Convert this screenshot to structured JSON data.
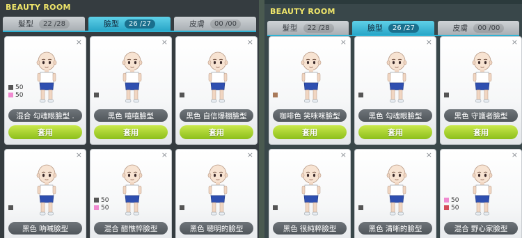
{
  "left_panel": {
    "title": "BEAUTY ROOM",
    "tabs": [
      {
        "label": "髮型",
        "count": "22 /28",
        "active": false
      },
      {
        "label": "臉型",
        "count": "26 /27",
        "active": true
      },
      {
        "label": "皮膚",
        "count": "00 /00",
        "active": false
      }
    ],
    "cards": [
      {
        "name": "混合 勾魂眼臉型 .",
        "swatches": [
          {
            "color": "#555555",
            "value": "50"
          },
          {
            "color": "#f08ad0",
            "value": "50"
          }
        ],
        "button": "套用"
      },
      {
        "name": "黑色 嘻嘻臉型",
        "swatches": [
          {
            "color": "#555555",
            "value": ""
          }
        ],
        "button": "套用"
      },
      {
        "name": "黑色 自信爆棚臉型",
        "swatches": [
          {
            "color": "#555555",
            "value": ""
          }
        ],
        "button": "套用"
      },
      {
        "name": "黑色 吶喊臉型",
        "swatches": [
          {
            "color": "#555555",
            "value": ""
          }
        ],
        "button": ""
      },
      {
        "name": "混合 醋憔悴臉型",
        "swatches": [
          {
            "color": "#555555",
            "value": "50"
          },
          {
            "color": "#f08ad0",
            "value": "50"
          }
        ],
        "button": ""
      },
      {
        "name": "黑色 聰明的臉型",
        "swatches": [
          {
            "color": "#555555",
            "value": ""
          }
        ],
        "button": ""
      }
    ]
  },
  "right_panel": {
    "title": "BEAUTY ROOM",
    "tabs": [
      {
        "label": "髮型",
        "count": "22 /28",
        "active": false
      },
      {
        "label": "臉型",
        "count": "26 /27",
        "active": true
      },
      {
        "label": "皮膚",
        "count": "00 /00",
        "active": false
      }
    ],
    "cards": [
      {
        "name": "咖啡色 笑咪咪臉型",
        "swatches": [
          {
            "color": "#a97a5a",
            "value": ""
          }
        ],
        "button": "套用"
      },
      {
        "name": "黑色 勾魂眼臉型",
        "swatches": [
          {
            "color": "#555555",
            "value": ""
          }
        ],
        "button": "套用"
      },
      {
        "name": "黑色 守護者臉型",
        "swatches": [
          {
            "color": "#555555",
            "value": ""
          }
        ],
        "button": "套用"
      },
      {
        "name": "黑色 很純粹臉型",
        "swatches": [
          {
            "color": "#555555",
            "value": ""
          }
        ],
        "button": ""
      },
      {
        "name": "黑色 清晰的臉型",
        "swatches": [
          {
            "color": "#555555",
            "value": ""
          }
        ],
        "button": ""
      },
      {
        "name": "混合 野心家臉型",
        "swatches": [
          {
            "color": "#f08ad0",
            "value": "50"
          },
          {
            "color": "#d44b59",
            "value": "50"
          }
        ],
        "button": ""
      }
    ]
  },
  "close_symbol": "×"
}
